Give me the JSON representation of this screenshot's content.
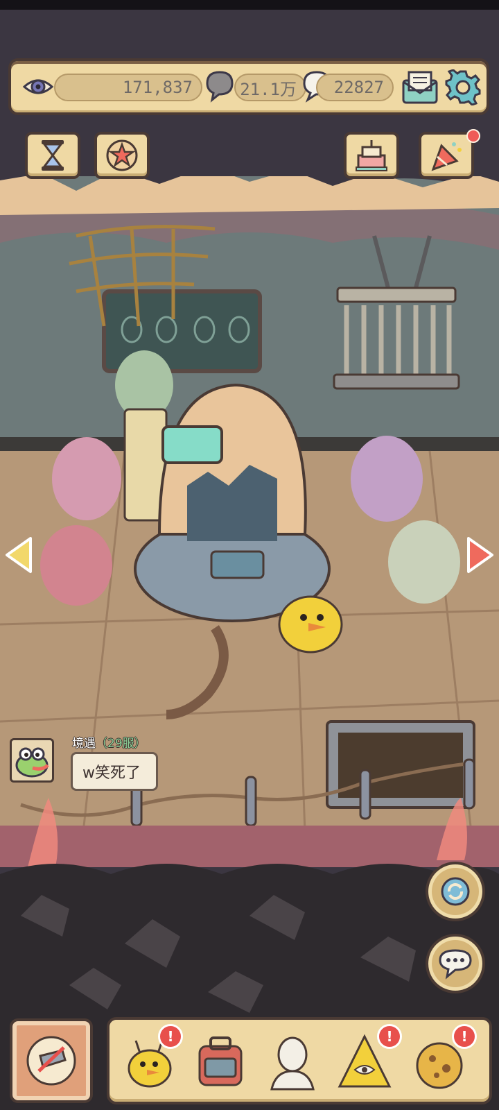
{
  "resources": {
    "eye_count": "171,837",
    "bubble_count": "21.1万",
    "message_count": "22827"
  },
  "chat": {
    "player_name": "境遇",
    "server": "（29服）",
    "message": "w笑死了"
  },
  "icons": {
    "eye": "eye-icon",
    "bubble": "speech-bubble-icon",
    "message": "message-icon",
    "mail": "mail-icon",
    "settings": "gear-icon",
    "hourglass": "hourglass-icon",
    "star": "star-icon",
    "cake": "cake-icon",
    "party": "party-popper-icon",
    "left_arrow": "arrow-left-icon",
    "right_arrow": "arrow-right-icon",
    "refresh": "refresh-icon",
    "chat": "chat-icon"
  },
  "colors": {
    "panel": "#efd9a4",
    "outline": "#4a3a34",
    "alert": "#e8504c",
    "server_tag": "#8fd39a"
  }
}
